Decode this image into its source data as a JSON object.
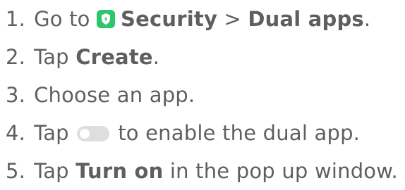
{
  "steps": [
    {
      "num": "1.",
      "pre": "Go to",
      "bold1": "Security",
      "mid": ">",
      "bold2": "Dual apps",
      "post": "."
    },
    {
      "num": "2.",
      "pre": "Tap",
      "bold": "Create",
      "post": "."
    },
    {
      "num": "3.",
      "text": "Choose an app."
    },
    {
      "num": "4.",
      "pre": "Tap",
      "post": "to enable the dual app."
    },
    {
      "num": "5.",
      "pre": "Tap",
      "bold": "Turn on",
      "post": "in the pop up window."
    }
  ],
  "icons": {
    "security_app": "shield-icon",
    "toggle": "toggle-switch-icon"
  },
  "colors": {
    "text": "#5f5f5f",
    "security_icon_bg": "#2ec56c",
    "toggle_track": "#dedede"
  }
}
